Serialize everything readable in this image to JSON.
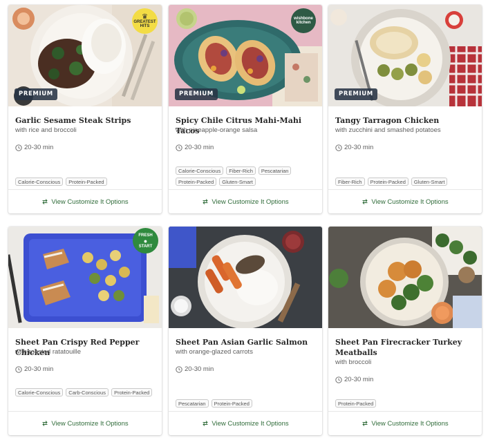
{
  "cards": [
    {
      "title": "Garlic Sesame Steak Strips",
      "subtitle": "with rice and broccoli",
      "time": "20-30 min",
      "premium_label": "PREMIUM",
      "badge": {
        "line1": "GREATEST",
        "line2": "HITS",
        "icon": "crown-icon",
        "color": "#f3dc45"
      },
      "tags": [
        "Calorie-Conscious",
        "Protein-Packed"
      ],
      "action_label": "View Customize It Options"
    },
    {
      "title": "Spicy Chile Citrus Mahi-Mahi Tacos",
      "subtitle": "with pineapple-orange salsa",
      "time": "20-30 min",
      "premium_label": "PREMIUM",
      "badge": {
        "line1": "wishbone",
        "line2": "kitchen",
        "color": "#2e5a45"
      },
      "tags": [
        "Calorie-Conscious",
        "Fiber-Rich",
        "Pescatarian",
        "Protein-Packed",
        "Gluten-Smart"
      ],
      "action_label": "View Customize It Options"
    },
    {
      "title": "Tangy Tarragon Chicken",
      "subtitle": "with zucchini and smashed potatoes",
      "time": "20-30 min",
      "premium_label": "PREMIUM",
      "tags": [
        "Fiber-Rich",
        "Protein-Packed",
        "Gluten-Smart"
      ],
      "action_label": "View Customize It Options"
    },
    {
      "title": "Sheet Pan Crispy Red Pepper Chicken",
      "subtitle": "with roasted ratatouille",
      "time": "20-30 min",
      "badge": {
        "line1": "FRESH",
        "line2": "START",
        "icon": "apple-icon",
        "color": "#2f8a3e"
      },
      "tags": [
        "Calorie-Conscious",
        "Carb-Conscious",
        "Protein-Packed"
      ],
      "action_label": "View Customize It Options"
    },
    {
      "title": "Sheet Pan Asian Garlic Salmon",
      "subtitle": "with orange-glazed carrots",
      "time": "20-30 min",
      "tags": [
        "Pescatarian",
        "Protein-Packed"
      ],
      "action_label": "View Customize It Options"
    },
    {
      "title": "Sheet Pan Firecracker Turkey Meatballs",
      "subtitle": "with broccoli",
      "time": "20-30 min",
      "tags": [
        "Protein-Packed"
      ],
      "action_label": "View Customize It Options"
    }
  ],
  "colors": {
    "accent_green": "#2f6b39",
    "premium_badge": "#283446",
    "tag_border": "#c9c9c9"
  }
}
